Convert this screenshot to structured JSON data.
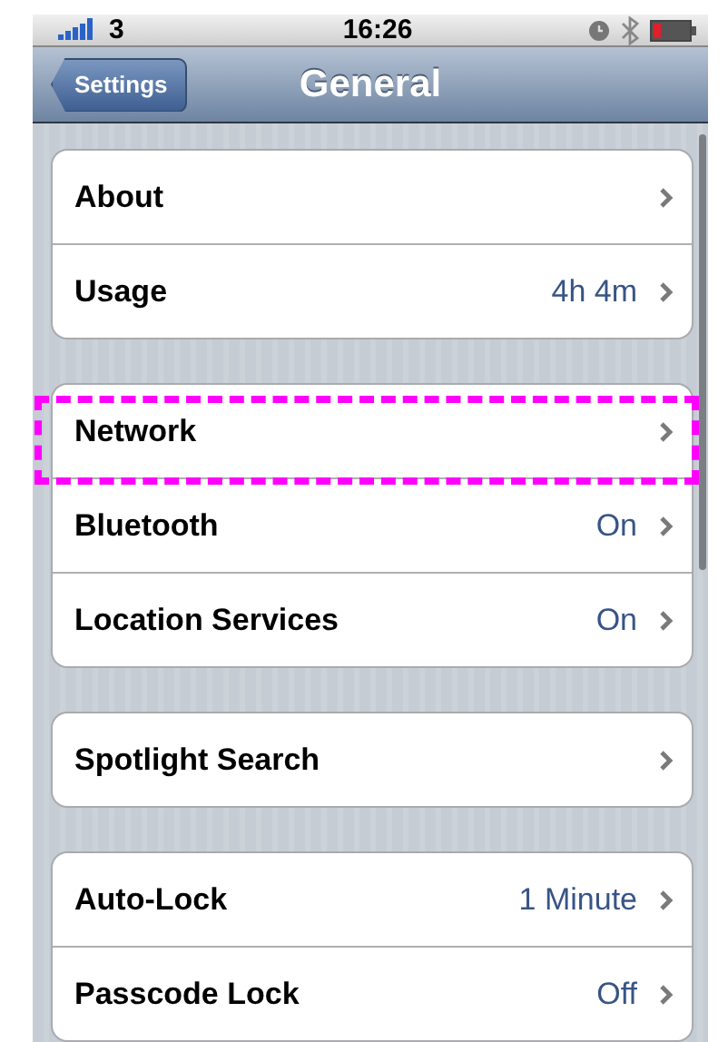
{
  "status_bar": {
    "carrier": "3",
    "time": "16:26"
  },
  "nav_bar": {
    "back_button": "Settings",
    "title": "General"
  },
  "groups": [
    {
      "rows": [
        {
          "label": "About",
          "highlighted": false
        },
        {
          "label": "Usage",
          "value": "4h 4m",
          "highlighted": false
        }
      ]
    },
    {
      "rows": [
        {
          "label": "Network",
          "highlighted": true
        },
        {
          "label": "Bluetooth",
          "value": "On",
          "highlighted": false
        },
        {
          "label": "Location Services",
          "value": "On",
          "highlighted": false
        }
      ]
    },
    {
      "rows": [
        {
          "label": "Spotlight Search",
          "highlighted": false
        }
      ]
    },
    {
      "rows": [
        {
          "label": "Auto-Lock",
          "value": "1 Minute",
          "highlighted": false
        },
        {
          "label": "Passcode Lock",
          "value": "Off",
          "highlighted": false
        }
      ]
    }
  ]
}
